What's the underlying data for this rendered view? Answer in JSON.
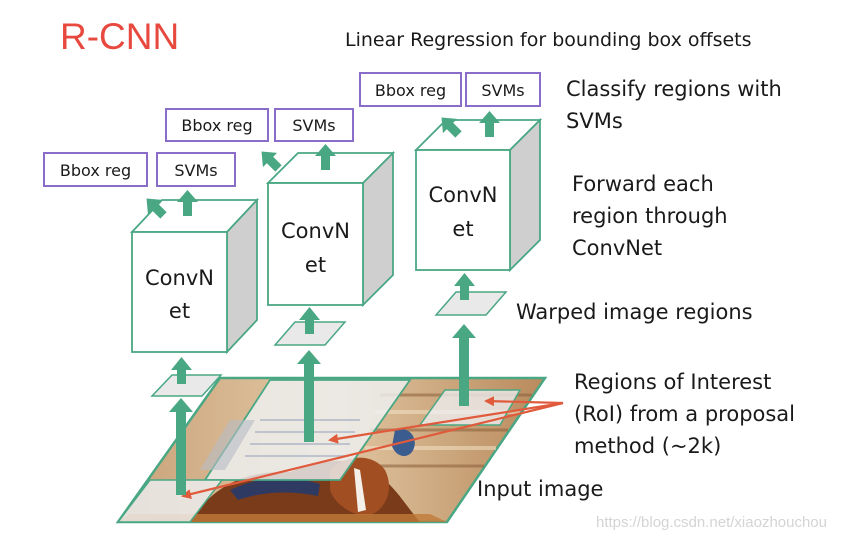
{
  "title": "R-CNN",
  "labels": {
    "linear_regression": "Linear Regression for bounding box offsets",
    "classify_line1": "Classify regions with",
    "classify_line2": "SVMs",
    "forward_line1": "Forward each",
    "forward_line2": "region through",
    "forward_line3": "ConvNet",
    "warped": "Warped image regions",
    "roi_line1": "Regions of Interest",
    "roi_line2": "(RoI) from a proposal",
    "roi_line3": "method (~2k)",
    "input_image": "Input image"
  },
  "pipelines": [
    {
      "bbox_label": "Bbox reg",
      "svm_label": "SVMs",
      "convnet_line1": "ConvN",
      "convnet_line2": "et"
    },
    {
      "bbox_label": "Bbox reg",
      "svm_label": "SVMs",
      "convnet_line1": "ConvN",
      "convnet_line2": "et"
    },
    {
      "bbox_label": "Bbox reg",
      "svm_label": "SVMs",
      "convnet_line1": "ConvN",
      "convnet_line2": "et"
    }
  ],
  "colors": {
    "title": "#e8493f",
    "green": "#4aa784",
    "green_stroke": "#3f8f6f",
    "purple": "#8a6cc9",
    "red_arrow": "#e05a3c",
    "cube_side": "#cfcfcf",
    "warped_fill": "#e9e9e9"
  },
  "watermark": "https://blog.csdn.net/xiaozhouchou"
}
